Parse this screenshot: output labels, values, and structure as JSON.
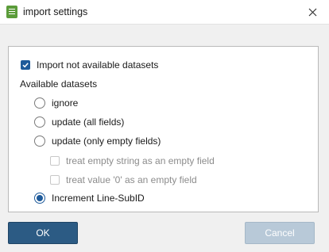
{
  "window": {
    "title": "import settings",
    "app_icon": "spreadsheet-icon",
    "close_icon": "close-icon"
  },
  "options": {
    "import_not_available": {
      "label": "Import not available datasets",
      "checked": true
    },
    "group_label": "Available datasets",
    "radios": [
      {
        "label": "ignore",
        "selected": false
      },
      {
        "label": "update (all fields)",
        "selected": false
      },
      {
        "label": "update (only empty fields)",
        "selected": false
      },
      {
        "label": "Increment Line-SubID",
        "selected": true
      }
    ],
    "sub_checkboxes": [
      {
        "label": "treat empty string as an empty field",
        "checked": false,
        "enabled": false
      },
      {
        "label": "treat value '0' as an empty field",
        "checked": false,
        "enabled": false
      }
    ]
  },
  "buttons": {
    "ok": "OK",
    "cancel": "Cancel"
  },
  "colors": {
    "accent": "#1e5a9a",
    "ok_button": "#2c5b84",
    "cancel_button_disabled": "#b8c9d8",
    "app_icon": "#5b9c3a"
  }
}
